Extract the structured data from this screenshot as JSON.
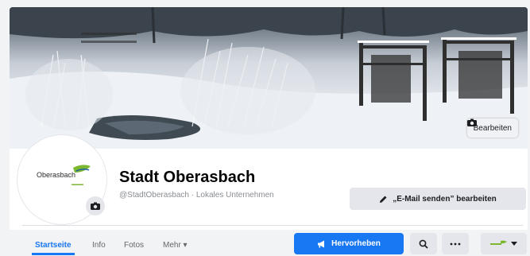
{
  "cover": {
    "edit_label": "Bearbeiten",
    "edit_icon": "camera-icon"
  },
  "profile": {
    "name": "Stadt Oberasbach",
    "handle": "@StadtOberasbach",
    "separator": " · ",
    "category": "Lokales Unternehmen",
    "logo_text": "Oberasbach",
    "logo_colors": {
      "green": "#7cb82f",
      "dark": "#2b2b2b",
      "blue": "#1f5fa8"
    },
    "avatar_camera_icon": "camera-icon"
  },
  "actions": {
    "email_label": "„E-Mail senden” bearbeiten",
    "email_icon": "pencil-icon",
    "promote_label": "Hervorheben",
    "promote_icon": "megaphone-icon",
    "search_icon": "search-icon",
    "more_icon": "more-icon",
    "switch_icon": "chevron-down-icon"
  },
  "tabs": [
    {
      "label": "Startseite",
      "active": true
    },
    {
      "label": "Info",
      "active": false
    },
    {
      "label": "Fotos",
      "active": false
    },
    {
      "label": "Mehr ▾",
      "active": false
    }
  ],
  "colors": {
    "accent": "#1877f2"
  }
}
